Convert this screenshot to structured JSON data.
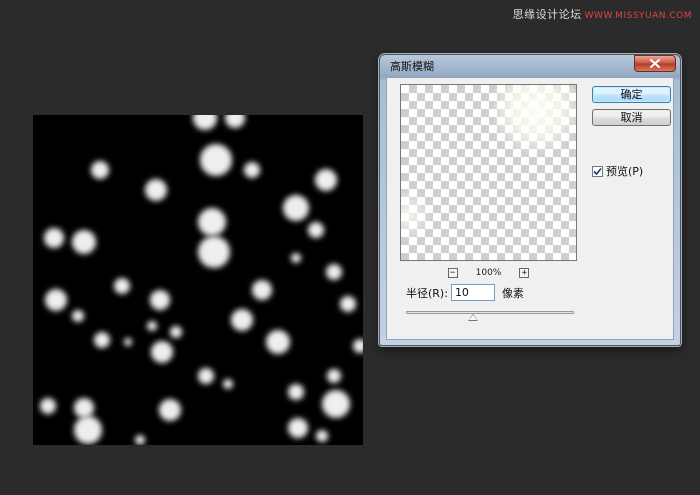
{
  "watermark": {
    "text": "思缘设计论坛",
    "url": "WWW.MISSYUAN.COM"
  },
  "canvas": {
    "particles": [
      [
        205,
        118,
        12
      ],
      [
        235,
        118,
        10
      ],
      [
        216,
        160,
        16
      ],
      [
        100,
        170,
        9
      ],
      [
        156,
        190,
        11
      ],
      [
        252,
        170,
        8
      ],
      [
        326,
        180,
        11
      ],
      [
        296,
        208,
        13
      ],
      [
        212,
        222,
        14
      ],
      [
        316,
        230,
        8
      ],
      [
        54,
        238,
        10
      ],
      [
        84,
        242,
        12
      ],
      [
        214,
        252,
        16
      ],
      [
        296,
        258,
        5
      ],
      [
        334,
        272,
        8
      ],
      [
        122,
        286,
        8
      ],
      [
        262,
        290,
        10
      ],
      [
        56,
        300,
        11
      ],
      [
        160,
        300,
        10
      ],
      [
        348,
        304,
        8
      ],
      [
        78,
        316,
        6
      ],
      [
        242,
        320,
        11
      ],
      [
        152,
        326,
        5
      ],
      [
        176,
        332,
        6
      ],
      [
        102,
        340,
        8
      ],
      [
        278,
        342,
        12
      ],
      [
        128,
        342,
        4
      ],
      [
        162,
        352,
        11
      ],
      [
        360,
        346,
        7
      ],
      [
        206,
        376,
        8
      ],
      [
        228,
        384,
        5
      ],
      [
        334,
        376,
        7
      ],
      [
        296,
        392,
        8
      ],
      [
        48,
        406,
        8
      ],
      [
        84,
        408,
        10
      ],
      [
        170,
        410,
        11
      ],
      [
        336,
        404,
        14
      ],
      [
        88,
        430,
        14
      ],
      [
        298,
        428,
        10
      ],
      [
        322,
        436,
        6
      ],
      [
        140,
        440,
        5
      ]
    ]
  },
  "dialog": {
    "title": "高斯模糊",
    "close_icon": "close-icon",
    "ok_label": "确定",
    "cancel_label": "取消",
    "preview_label": "预览(P)",
    "preview_checked": true,
    "zoom": {
      "level": "100%",
      "minus": "−",
      "plus": "+"
    },
    "radius": {
      "label": "半径(R):",
      "value": "10",
      "unit": "像素",
      "slider_fraction": 0.4
    }
  }
}
